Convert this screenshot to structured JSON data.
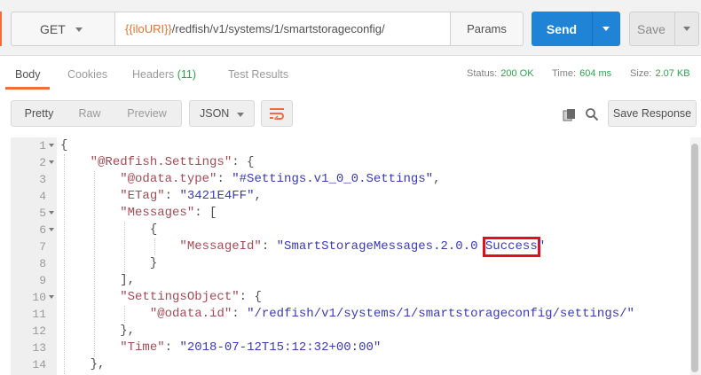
{
  "request": {
    "method": "GET",
    "url_var": "{{iloURI}}",
    "url_path": "/redfish/v1/systems/1/smartstorageconfig/",
    "params_label": "Params",
    "send_label": "Send",
    "save_label": "Save"
  },
  "tabs": {
    "body": "Body",
    "cookies": "Cookies",
    "headers": "Headers",
    "headers_count": "(11)",
    "tests": "Test Results"
  },
  "meta": {
    "status_label": "Status:",
    "status_value": "200 OK",
    "time_label": "Time:",
    "time_value": "604 ms",
    "size_label": "Size:",
    "size_value": "2.07 KB"
  },
  "toolbar": {
    "pretty": "Pretty",
    "raw": "Raw",
    "preview": "Preview",
    "format": "JSON",
    "save_response": "Save Response"
  },
  "code": {
    "l1": "{",
    "l2_key": "\"@Redfish.Settings\"",
    "l2_rest": ": {",
    "l3_key": "\"@odata.type\"",
    "l3_sep": ": ",
    "l3_val": "\"#Settings.v1_0_0.Settings\"",
    "l3_end": ",",
    "l4_key": "\"ETag\"",
    "l4_sep": ": ",
    "l4_val": "\"3421E4FF\"",
    "l4_end": ",",
    "l5_key": "\"Messages\"",
    "l5_rest": ": [",
    "l6": "{",
    "l7_key": "\"MessageId\"",
    "l7_sep": ": ",
    "l7_val_a": "\"SmartStorageMessages.2.0.0 ",
    "l7_val_b": "Success",
    "l7_val_c": "\"",
    "l8": "}",
    "l9": "],",
    "l10_key": "\"SettingsObject\"",
    "l10_rest": ": {",
    "l11_key": "\"@odata.id\"",
    "l11_sep": ": ",
    "l11_val": "\"/redfish/v1/systems/1/smartstorageconfig/settings/\"",
    "l12": "},",
    "l13_key": "\"Time\"",
    "l13_sep": ": ",
    "l13_val": "\"2018-07-12T15:12:32+00:00\"",
    "l14": "},"
  },
  "line_numbers": [
    "1",
    "2",
    "3",
    "4",
    "5",
    "6",
    "7",
    "8",
    "9",
    "10",
    "11",
    "12",
    "13",
    "14"
  ],
  "colors": {
    "send": "#1f84d6",
    "accent": "#f26b3a",
    "status_ok": "#2aa64c",
    "json_key": "#a54a55",
    "json_string": "#3a3ab8",
    "highlight_box": "#e0101c"
  }
}
